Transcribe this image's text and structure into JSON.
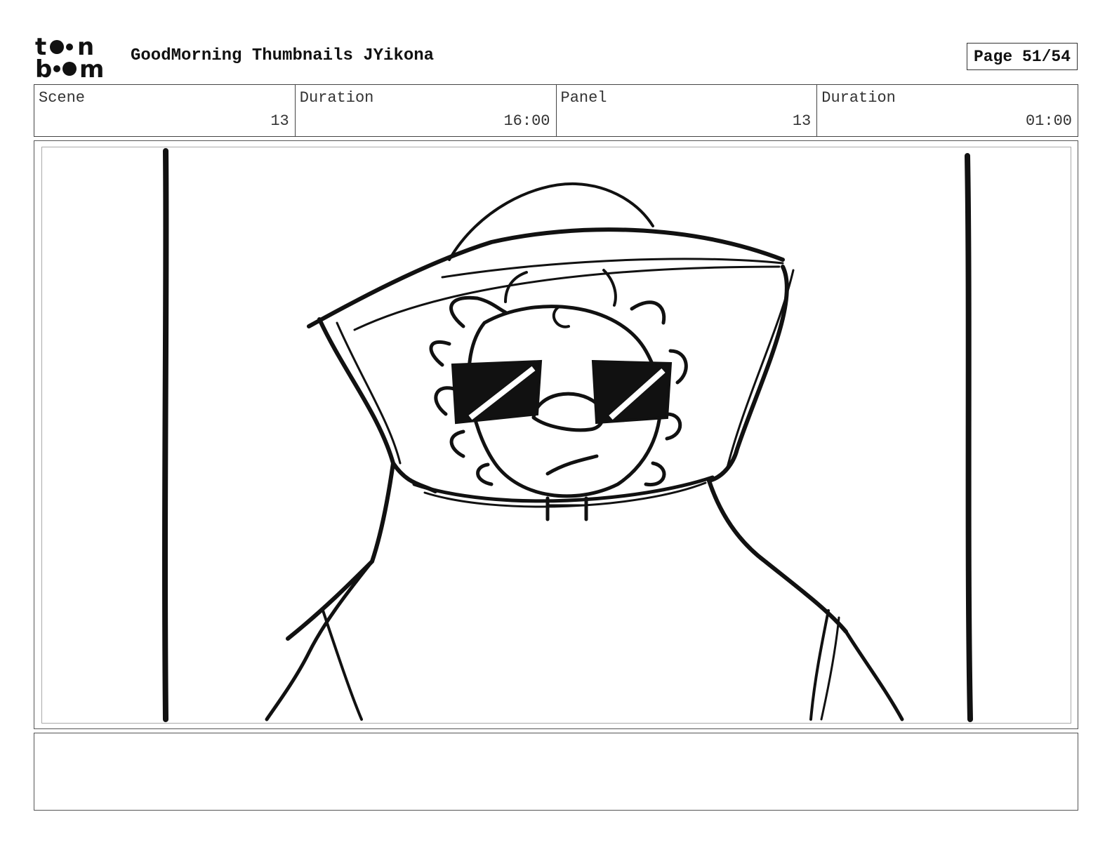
{
  "header": {
    "logo_text": "toon boom",
    "title": "GoodMorning Thumbnails JYikona",
    "page": "Page 51/54"
  },
  "info": [
    {
      "label": "Scene",
      "value": "13"
    },
    {
      "label": "Duration",
      "value": "16:00"
    },
    {
      "label": "Panel",
      "value": "13"
    },
    {
      "label": "Duration",
      "value": "01:00"
    }
  ],
  "notes": {
    "text": ""
  }
}
